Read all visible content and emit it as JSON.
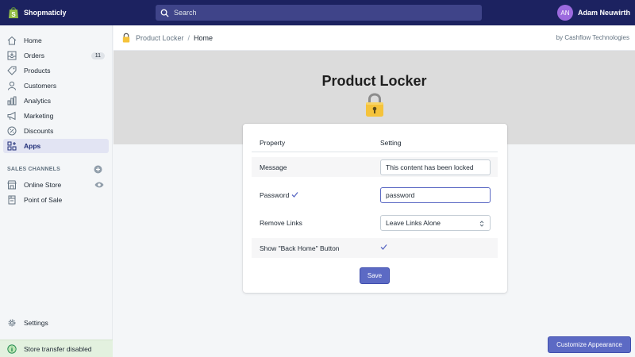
{
  "topbar": {
    "brand_name": "Shopmaticly",
    "search_placeholder": "Search",
    "user_initials": "AN",
    "user_name": "Adam Neuwirth"
  },
  "sidebar": {
    "items": [
      {
        "label": "Home",
        "icon": "home-icon"
      },
      {
        "label": "Orders",
        "icon": "orders-icon",
        "badge": "11"
      },
      {
        "label": "Products",
        "icon": "tag-icon"
      },
      {
        "label": "Customers",
        "icon": "person-icon"
      },
      {
        "label": "Analytics",
        "icon": "bar-chart-icon"
      },
      {
        "label": "Marketing",
        "icon": "megaphone-icon"
      },
      {
        "label": "Discounts",
        "icon": "discount-icon"
      },
      {
        "label": "Apps",
        "icon": "apps-icon",
        "active": true
      }
    ],
    "sales_channels_title": "SALES CHANNELS",
    "channels": [
      {
        "label": "Online Store",
        "icon": "store-icon"
      },
      {
        "label": "Point of Sale",
        "icon": "pos-icon"
      }
    ],
    "settings_label": "Settings",
    "store_transfer_label": "Store transfer disabled"
  },
  "breadcrumb": {
    "app": "Product Locker",
    "separator": "/",
    "current": "Home",
    "vendor": "by Cashflow Technologies"
  },
  "hero": {
    "title": "Product Locker"
  },
  "settings_table": {
    "col_property": "Property",
    "col_setting": "Setting",
    "message_label": "Message",
    "message_value": "This content has been locked",
    "password_label": "Password",
    "password_value": "password",
    "remove_links_label": "Remove Links",
    "remove_links_value": "Leave Links Alone",
    "back_home_label": "Show \"Back Home\" Button",
    "back_home_checked": true,
    "save_label": "Save"
  },
  "customize_label": "Customize Appearance",
  "colors": {
    "topbar": "#1c2260",
    "accent": "#5c6ac4",
    "hero_bg": "#dcdcdc",
    "active_nav": "#e2e4f3"
  }
}
